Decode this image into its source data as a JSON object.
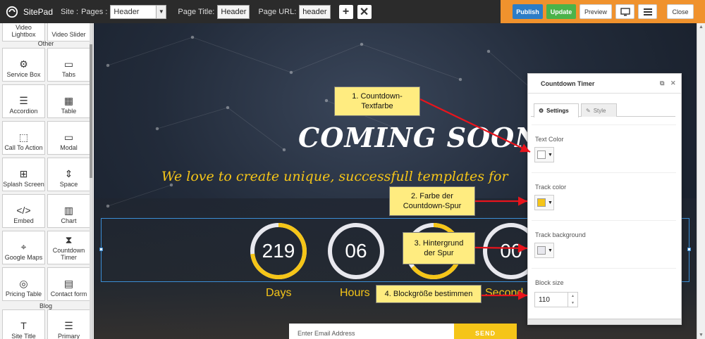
{
  "topbar": {
    "app_name": "SitePad",
    "site_label": "Site :",
    "pages_label": "Pages :",
    "pages_value": "Header",
    "page_title_label": "Page Title:",
    "page_title_value": "Header",
    "page_url_label": "Page URL:",
    "page_url_value": "header",
    "add_icon": "+",
    "delete_icon": "✕",
    "publish": "Publish",
    "update": "Update",
    "preview": "Preview",
    "close": "Close",
    "accent_color": "#f0922d"
  },
  "sidebar": {
    "top_partial": [
      "Video Lightbox",
      "Video Slider"
    ],
    "section_other": "Other",
    "widgets": [
      {
        "label": "Service Box",
        "icon": "⚙"
      },
      {
        "label": "Tabs",
        "icon": "▭"
      },
      {
        "label": "Accordion",
        "icon": "☰"
      },
      {
        "label": "Table",
        "icon": "▦"
      },
      {
        "label": "Call To Action",
        "icon": "⬚"
      },
      {
        "label": "Modal",
        "icon": "▭"
      },
      {
        "label": "Splash Screen",
        "icon": "⊞"
      },
      {
        "label": "Space",
        "icon": "⇕"
      },
      {
        "label": "Embed",
        "icon": "</>"
      },
      {
        "label": "Chart",
        "icon": "▥"
      },
      {
        "label": "Google Maps",
        "icon": "⌖"
      },
      {
        "label": "Countdown Timer",
        "icon": "⧗"
      },
      {
        "label": "Pricing Table",
        "icon": "◎"
      },
      {
        "label": "Contact form",
        "icon": "▤"
      }
    ],
    "section_blog": "Blog",
    "blog_widgets": [
      {
        "label": "Site Title",
        "icon": "T"
      },
      {
        "label": "Primary",
        "icon": "☰"
      }
    ]
  },
  "canvas": {
    "heading": "COMING SOON",
    "subtitle": "We love to create unique, successfull templates for",
    "countdown": [
      {
        "value": "219",
        "label": "Days"
      },
      {
        "value": "06",
        "label": "Hours"
      },
      {
        "value": "",
        "label": ""
      },
      {
        "value": "00",
        "label": "Second"
      }
    ],
    "email_placeholder": "Enter Email Address",
    "send_label": "SEND",
    "accent_color": "#f5c518"
  },
  "panel": {
    "title": "Countdown Timer",
    "tab_settings": "Settings",
    "tab_style": "Style",
    "text_color_label": "Text Color",
    "text_color_value": "#ffffff",
    "track_color_label": "Track color",
    "track_color_value": "#f5c518",
    "track_bg_label": "Track background",
    "track_bg_value": "#e8e8ee",
    "block_size_label": "Block size",
    "block_size_value": "110"
  },
  "annotations": {
    "note1": "1. Countdown-\nTextfarbe",
    "note2": "2. Farbe der\nCountdown-Spur",
    "note3": "3. Hintergrund\nder Spur",
    "note4": "4. Blockgröße bestimmen",
    "arrow_color": "#e8141c"
  }
}
